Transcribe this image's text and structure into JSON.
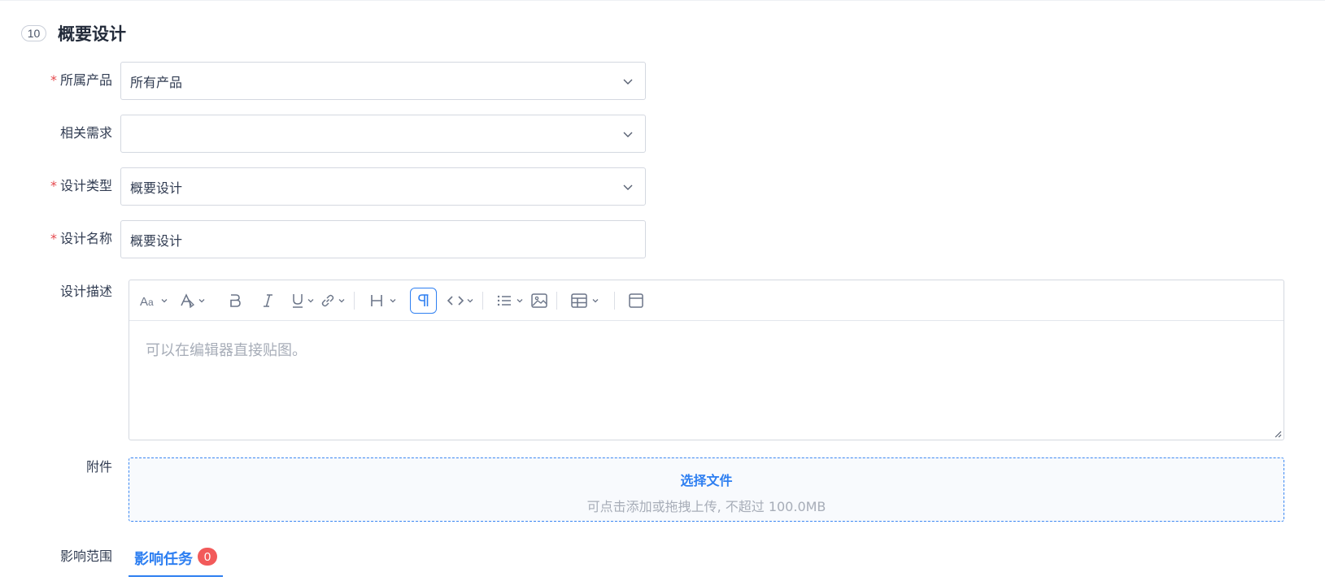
{
  "section": {
    "step": "10",
    "title": "概要设计"
  },
  "form": {
    "product": {
      "label": "所属产品",
      "required": "*",
      "value": "所有产品"
    },
    "requirement": {
      "label": "相关需求",
      "value": ""
    },
    "design_type": {
      "label": "设计类型",
      "required": "*",
      "value": "概要设计"
    },
    "design_name": {
      "label": "设计名称",
      "required": "*",
      "value": "概要设计"
    },
    "description": {
      "label": "设计描述",
      "placeholder": "可以在编辑器直接贴图。"
    },
    "attachment": {
      "label": "附件",
      "pick": "选择文件",
      "hint": "可点击添加或拖拽上传, 不超过 100.0MB"
    },
    "impact": {
      "label": "影响范围",
      "tab": "影响任务",
      "count": "0"
    }
  },
  "toolbar": {
    "icons": [
      "font-size-icon",
      "font-color-icon",
      "bold-icon",
      "italic-icon",
      "underline-icon",
      "link-icon",
      "heading-icon",
      "paragraph-icon",
      "code-icon",
      "list-icon",
      "image-icon",
      "table-icon",
      "fullscreen-icon"
    ]
  },
  "colors": {
    "accent": "#2e7ff1",
    "required": "#e5484d",
    "badge": "#f25a5a",
    "border": "#d4d8e0"
  }
}
